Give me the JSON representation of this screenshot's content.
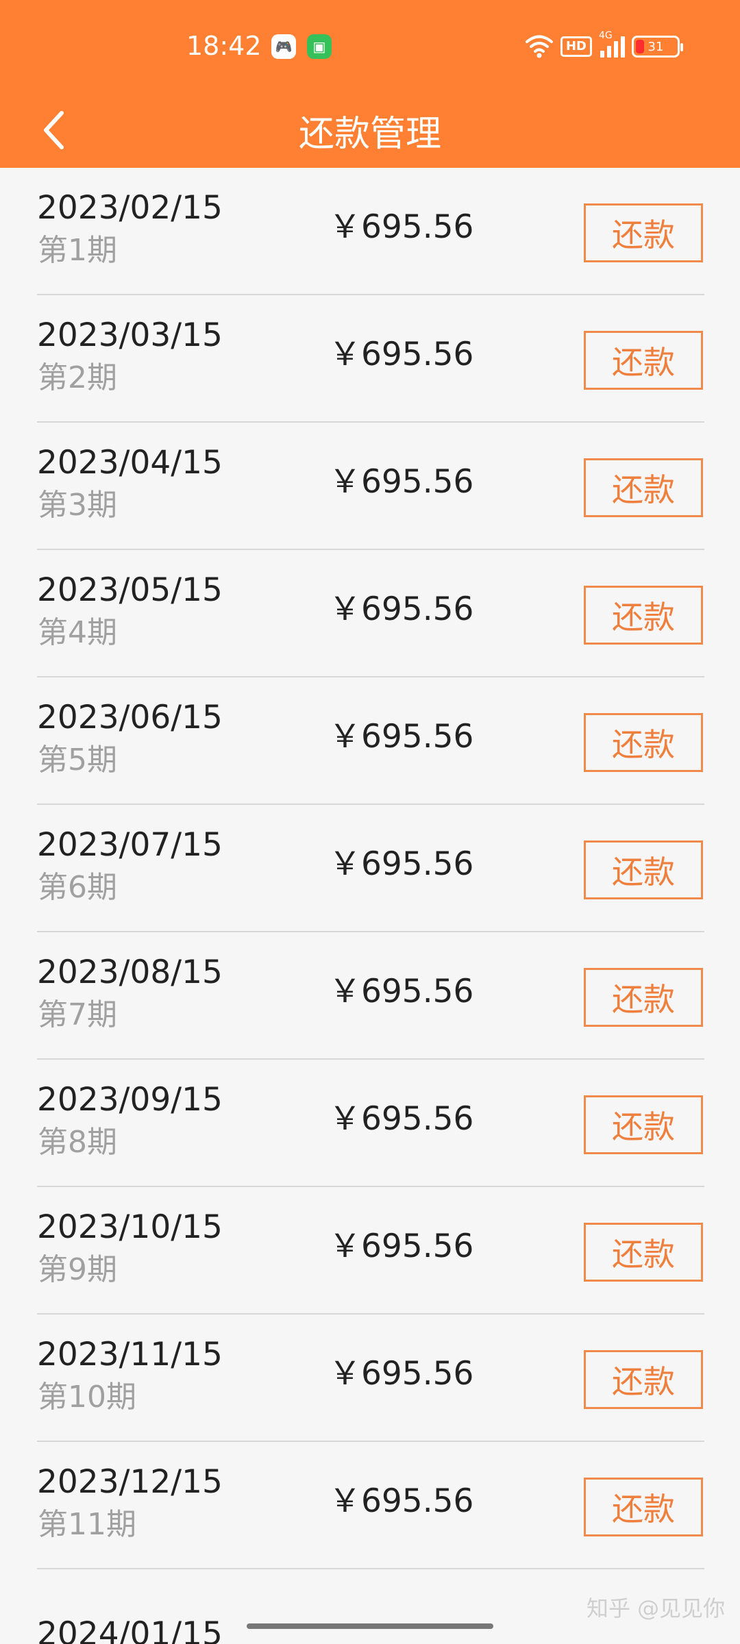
{
  "status_bar": {
    "time": "18:42",
    "hd": "HD",
    "network": "4G",
    "battery": "31"
  },
  "header": {
    "title": "还款管理"
  },
  "theme": {
    "header_color": "#ff8033",
    "button_border": "#f08a4a",
    "button_text": "#ef7f3d",
    "secondary_text": "#a0a0a0"
  },
  "rows": [
    {
      "date": "2023/02/15",
      "period": "第1期",
      "amount": "￥695.56",
      "button": "还款"
    },
    {
      "date": "2023/03/15",
      "period": "第2期",
      "amount": "￥695.56",
      "button": "还款"
    },
    {
      "date": "2023/04/15",
      "period": "第3期",
      "amount": "￥695.56",
      "button": "还款"
    },
    {
      "date": "2023/05/15",
      "period": "第4期",
      "amount": "￥695.56",
      "button": "还款"
    },
    {
      "date": "2023/06/15",
      "period": "第5期",
      "amount": "￥695.56",
      "button": "还款"
    },
    {
      "date": "2023/07/15",
      "period": "第6期",
      "amount": "￥695.56",
      "button": "还款"
    },
    {
      "date": "2023/08/15",
      "period": "第7期",
      "amount": "￥695.56",
      "button": "还款"
    },
    {
      "date": "2023/09/15",
      "period": "第8期",
      "amount": "￥695.56",
      "button": "还款"
    },
    {
      "date": "2023/10/15",
      "period": "第9期",
      "amount": "￥695.56",
      "button": "还款"
    },
    {
      "date": "2023/11/15",
      "period": "第10期",
      "amount": "￥695.56",
      "button": "还款"
    },
    {
      "date": "2023/12/15",
      "period": "第11期",
      "amount": "￥695.56",
      "button": "还款"
    }
  ],
  "partial_row": {
    "date": "2024/01/15"
  },
  "watermark": "知乎 @见见你"
}
